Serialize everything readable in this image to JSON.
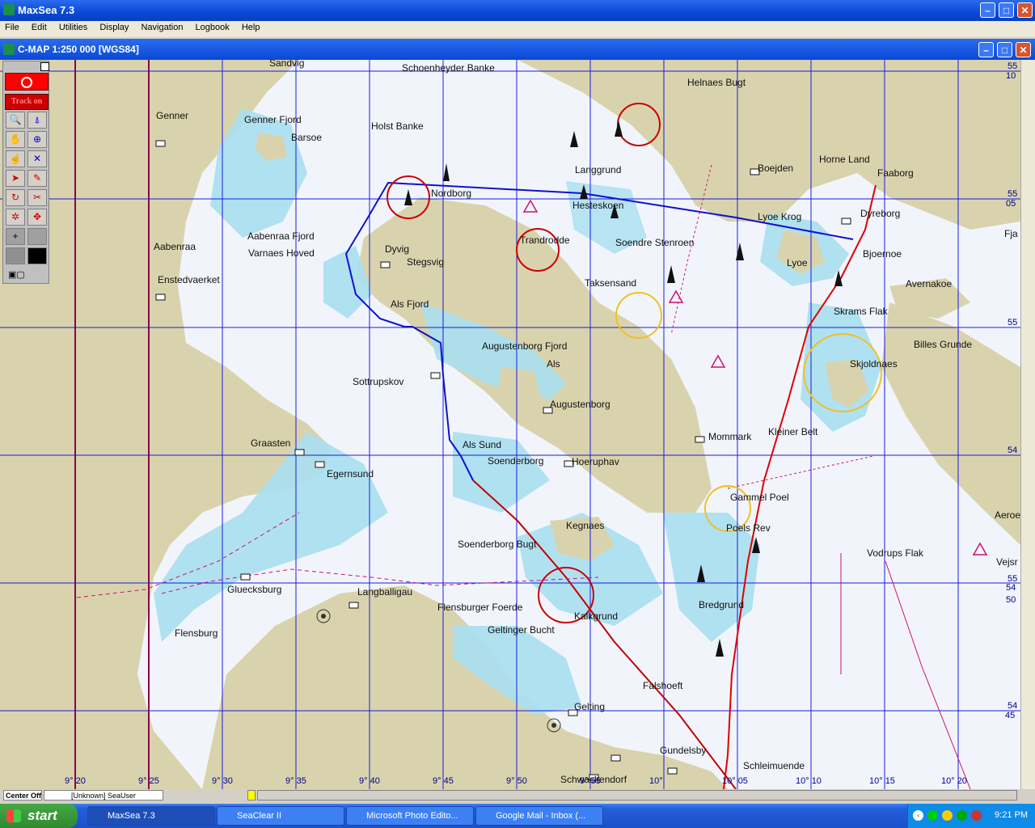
{
  "app": {
    "title": "MaxSea 7.3",
    "menu": [
      "File",
      "Edit",
      "Utilities",
      "Display",
      "Navigation",
      "Logbook",
      "Help"
    ]
  },
  "chart_window": {
    "title": "C-MAP  1:250 000 [WGS84]"
  },
  "toolbox": {
    "track_label": "Track on"
  },
  "map": {
    "places": [
      {
        "name": "Sandvig"
      },
      {
        "name": "Schoenheyder Banke"
      },
      {
        "name": "Helnaes Bugt"
      },
      {
        "name": "Genner"
      },
      {
        "name": "Genner Fjord"
      },
      {
        "name": "Holst Banke"
      },
      {
        "name": "Barsoe"
      },
      {
        "name": "Langgrund"
      },
      {
        "name": "Boejden"
      },
      {
        "name": "Horne Land"
      },
      {
        "name": "Faaborg"
      },
      {
        "name": "Nordborg"
      },
      {
        "name": "Hesteskoen"
      },
      {
        "name": "Lyoe Krog"
      },
      {
        "name": "Dyreborg"
      },
      {
        "name": "Aabenraa"
      },
      {
        "name": "Aabenraa Fjord"
      },
      {
        "name": "Varnaes Hoved"
      },
      {
        "name": "Dyvig"
      },
      {
        "name": "Stegsvig"
      },
      {
        "name": "Trandrodde"
      },
      {
        "name": "Soendre Stenroen"
      },
      {
        "name": "Lyoe"
      },
      {
        "name": "Bjoernoe"
      },
      {
        "name": "Enstedvaerket"
      },
      {
        "name": "Taksensand"
      },
      {
        "name": "Avernakoe"
      },
      {
        "name": "Als Fjord"
      },
      {
        "name": "Skrams Flak"
      },
      {
        "name": "Augustenborg Fjord"
      },
      {
        "name": "Billes Grunde"
      },
      {
        "name": "Als"
      },
      {
        "name": "Skjoldnaes"
      },
      {
        "name": "Sottrupskov"
      },
      {
        "name": "Augustenborg"
      },
      {
        "name": "Graasten"
      },
      {
        "name": "Als Sund"
      },
      {
        "name": "Mommark"
      },
      {
        "name": "Kleiner Belt"
      },
      {
        "name": "Soenderborg"
      },
      {
        "name": "Hoeruphav"
      },
      {
        "name": "Egernsund"
      },
      {
        "name": "Gammel Poel"
      },
      {
        "name": "Aeroe"
      },
      {
        "name": "Kegnaes"
      },
      {
        "name": "Poels Rev"
      },
      {
        "name": "Soenderborg Bugt"
      },
      {
        "name": "Vodrups Flak"
      },
      {
        "name": "Vejsr"
      },
      {
        "name": "Gluecksburg"
      },
      {
        "name": "Langballigau"
      },
      {
        "name": "Flensburger Foerde"
      },
      {
        "name": "Bredgrund"
      },
      {
        "name": "Kalkgrund"
      },
      {
        "name": "Flensburg"
      },
      {
        "name": "Geltinger Bucht"
      },
      {
        "name": "Falshoeft"
      },
      {
        "name": "Gelting"
      },
      {
        "name": "Gundelsby"
      },
      {
        "name": "Schleimuende"
      },
      {
        "name": "Schwackendorf"
      },
      {
        "name": "Fja"
      }
    ],
    "lon_labels": [
      "9° 20",
      "9° 25",
      "9° 30",
      "9° 35",
      "9° 40",
      "9° 45",
      "9° 50",
      "9° 55",
      "10°",
      "10° 05",
      "10° 10",
      "10° 15",
      "10° 20"
    ],
    "lat_labels": [
      "55",
      "10",
      "55",
      "05",
      "55",
      "54",
      "55",
      "54",
      "50",
      "54",
      "45",
      "54"
    ]
  },
  "statusbar": {
    "center": "Center Off",
    "user": "[Unknown] SeaUser"
  },
  "taskbar": {
    "start": "start",
    "items": [
      "MaxSea 7.3",
      "SeaClear II",
      "Microsoft Photo Edito...",
      "Google Mail - Inbox (..."
    ],
    "clock": "9:21 PM"
  },
  "colors": {
    "land": "#d9d3ad",
    "shallow": "#a9dff0",
    "deep": "#f1f5fb",
    "grid": "#1a1ae0",
    "route_red": "#e00000",
    "route_blue": "#1010d0"
  }
}
